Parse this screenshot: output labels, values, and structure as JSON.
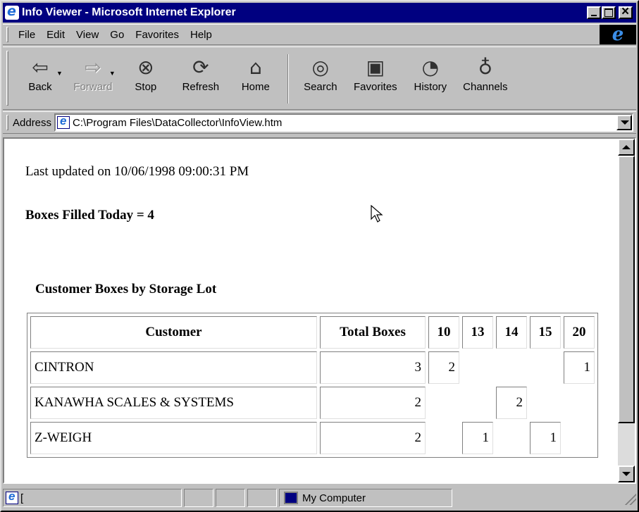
{
  "window": {
    "title": "Info Viewer - Microsoft Internet Explorer"
  },
  "menu": {
    "items": [
      {
        "label": "File"
      },
      {
        "label": "Edit"
      },
      {
        "label": "View"
      },
      {
        "label": "Go"
      },
      {
        "label": "Favorites"
      },
      {
        "label": "Help"
      }
    ]
  },
  "toolbar": {
    "back": "Back",
    "forward": "Forward",
    "stop": "Stop",
    "refresh": "Refresh",
    "home": "Home",
    "search": "Search",
    "favorites": "Favorites",
    "history": "History",
    "channels": "Channels"
  },
  "address": {
    "label": "Address",
    "value": "C:\\Program Files\\DataCollector\\InfoView.htm"
  },
  "page": {
    "last_updated": "Last updated on 10/06/1998 09:00:31 PM",
    "boxes_filled": "Boxes Filled Today = 4",
    "section_title": "Customer Boxes by Storage Lot",
    "table": {
      "headers": {
        "customer": "Customer",
        "total": "Total Boxes",
        "lots": [
          "10",
          "13",
          "14",
          "15",
          "20"
        ]
      },
      "rows": [
        {
          "customer": "CINTRON",
          "total": "3",
          "lots": [
            "2",
            "",
            "",
            "",
            "1"
          ]
        },
        {
          "customer": "KANAWHA SCALES & SYSTEMS",
          "total": "2",
          "lots": [
            "",
            "",
            "2",
            "",
            ""
          ]
        },
        {
          "customer": "Z-WEIGH",
          "total": "2",
          "lots": [
            "",
            "1",
            "",
            "1",
            ""
          ]
        }
      ]
    }
  },
  "status": {
    "zone": "My Computer"
  }
}
